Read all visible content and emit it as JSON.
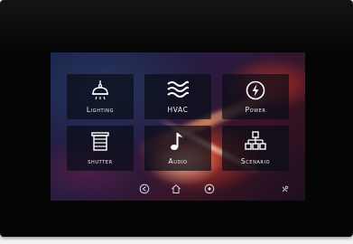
{
  "tiles": [
    {
      "label": "Lighting",
      "icon": "ceiling-lamp-icon"
    },
    {
      "label": "HVAC",
      "icon": "waves-icon"
    },
    {
      "label": "Power",
      "icon": "power-bolt-icon"
    },
    {
      "label": "shutter",
      "icon": "shutter-icon"
    },
    {
      "label": "Audio",
      "icon": "music-note-icon"
    },
    {
      "label": "Scenario",
      "icon": "network-hierarchy-icon"
    }
  ],
  "nav_icons": [
    "back-icon",
    "home-icon",
    "menu-dot-icon",
    "settings-icon"
  ],
  "colors": {
    "bezel": "#050505",
    "tile_bg": "#0a0c18",
    "icon": "#ffffff",
    "accent_glow": "#d23c28"
  }
}
